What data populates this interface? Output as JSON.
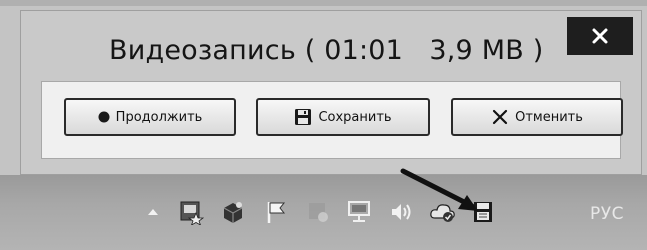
{
  "recorder": {
    "title": "Видеозапись ( 01:01   3,9 MB )",
    "elapsed_time": "01:01",
    "file_size": "3,9 MB",
    "buttons": {
      "continue_label": "Продолжить",
      "save_label": "Сохранить",
      "cancel_label": "Отменить"
    },
    "close_icon": "close-icon"
  },
  "taskbar": {
    "tray_icons": [
      "show-hidden-icons-arrow",
      "network-star-icon",
      "app-box-icon",
      "action-center-flag-icon",
      "faded-app-icon",
      "monitor-network-icon",
      "volume-icon",
      "cloud-sync-icon",
      "save-recording-icon"
    ],
    "language": "РУС"
  },
  "colors": {
    "close_button_bg": "#1e1e1e",
    "panel_bg": "#f0f0f0",
    "taskbar_bg": "#a8a8a8"
  }
}
